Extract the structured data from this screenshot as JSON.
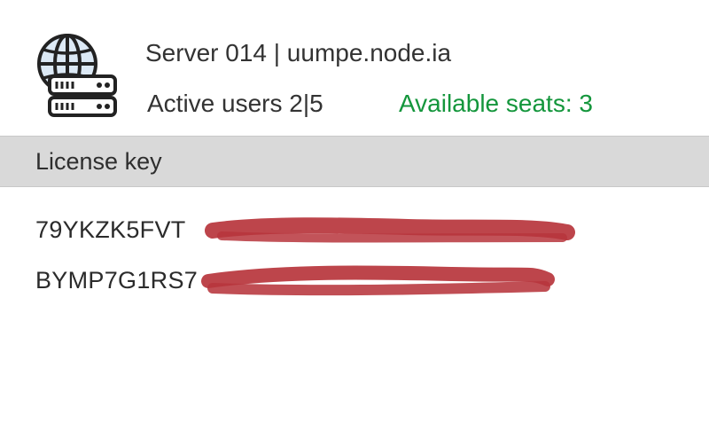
{
  "server": {
    "icon": "globe-server-icon",
    "title": "Server 014 | uumpe.node.ia",
    "active_users": "Active users 2|5",
    "available_seats": "Available seats: 3"
  },
  "license": {
    "section_title": "License key",
    "keys": [
      {
        "visible_prefix": "79YKZK5FVT"
      },
      {
        "visible_prefix": "BYMP7G1RS7"
      }
    ]
  },
  "colors": {
    "available": "#14963c",
    "redaction": "#b7353c",
    "section_bg": "#d9d9d9"
  }
}
